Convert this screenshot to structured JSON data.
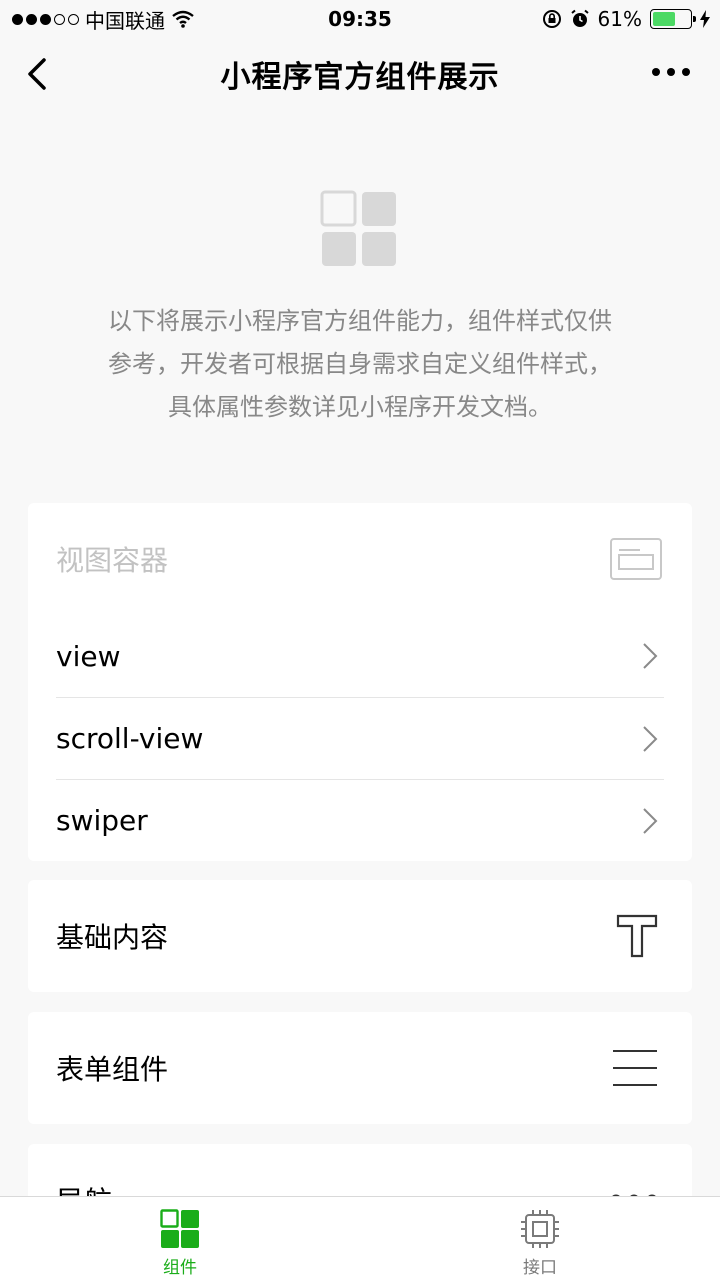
{
  "status_bar": {
    "carrier": "中国联通",
    "time": "09:35",
    "battery": "61%",
    "battery_level": 0.61,
    "signal_dots_filled": 3,
    "signal_dots_total": 5
  },
  "nav": {
    "title": "小程序官方组件展示",
    "back_icon": "chevron-left-icon",
    "more_icon": "more-dots-icon"
  },
  "intro": {
    "lines": [
      "以下将展示小程序官方组件能力，组件样式仅供",
      "参考，开发者可根据自身需求自定义组件样式，",
      "具体属性参数详见小程序开发文档。"
    ]
  },
  "groups": {
    "view_container": {
      "label": "视图容器",
      "icon": "view-container-icon",
      "items": [
        {
          "label": "view"
        },
        {
          "label": "scroll-view"
        },
        {
          "label": "swiper"
        }
      ]
    },
    "basic_content": {
      "label": "基础内容",
      "icon": "text-t-icon"
    },
    "form_components": {
      "label": "表单组件",
      "icon": "form-lines-icon"
    },
    "navigation": {
      "label": "导航",
      "icon": "more-dots-icon"
    }
  },
  "tab_bar": {
    "tabs": [
      {
        "label": "组件",
        "icon": "components-grid-icon",
        "active": true
      },
      {
        "label": "接口",
        "icon": "chip-icon",
        "active": false
      }
    ],
    "active_color": "#1aad19",
    "inactive_color": "#7a7a7a"
  },
  "colors": {
    "background": "#f8f8f8",
    "card": "#ffffff",
    "accent": "#1aad19",
    "battery": "#4cd964"
  }
}
